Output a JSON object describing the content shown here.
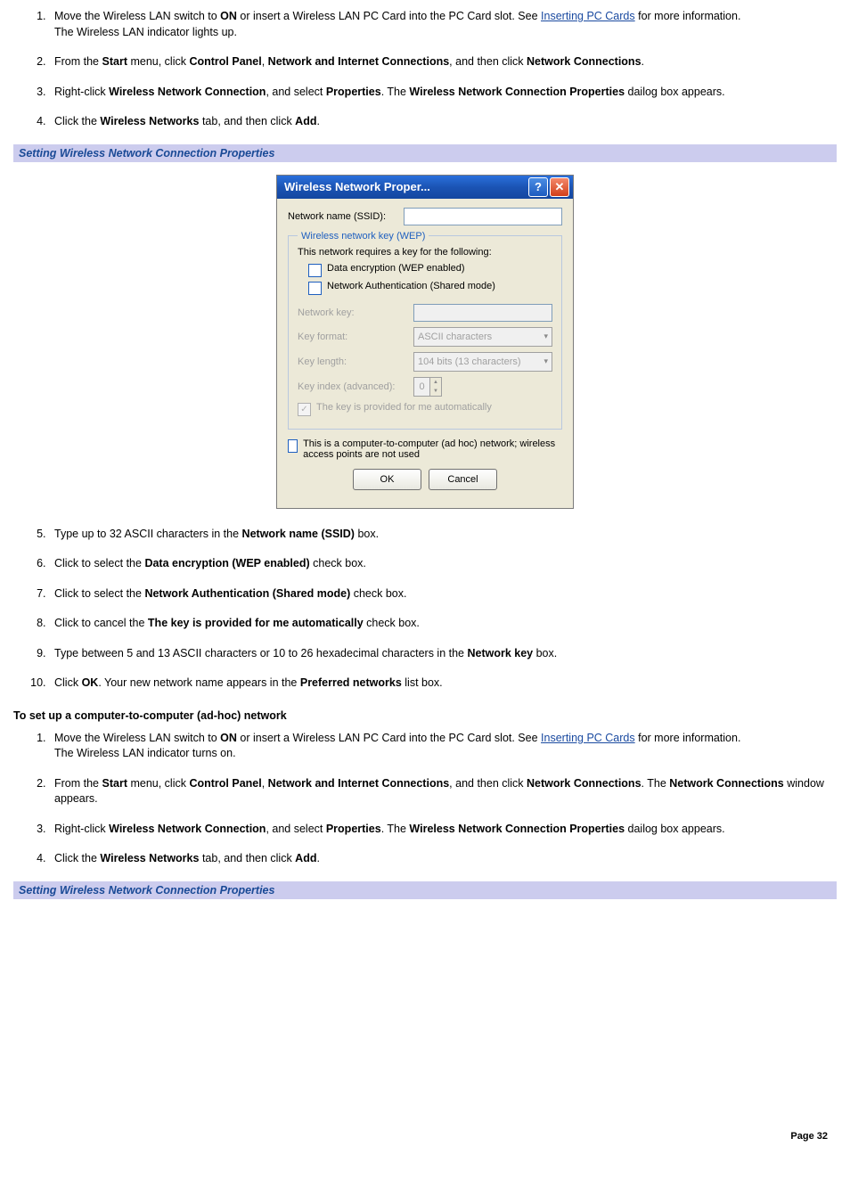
{
  "steps_a": {
    "s1_pre": "Move the Wireless LAN switch to ",
    "s1_b1": "ON",
    "s1_mid": " or insert a Wireless LAN PC Card into the PC Card slot. See ",
    "s1_link": "Inserting PC Cards",
    "s1_post": " for more information.",
    "s1_line2": "The Wireless LAN indicator lights up.",
    "s2_p0": "From the ",
    "s2_b1": "Start",
    "s2_p1": " menu, click ",
    "s2_b2": "Control Panel",
    "s2_p2": ", ",
    "s2_b3": "Network and Internet Connections",
    "s2_p3": ", and then click ",
    "s2_b4": "Network Connections",
    "s2_p4": ".",
    "s3_p0": "Right-click ",
    "s3_b1": "Wireless Network Connection",
    "s3_p1": ", and select ",
    "s3_b2": "Properties",
    "s3_p2": ". The ",
    "s3_b3": "Wireless Network Connection Properties",
    "s3_p3": " dailog box appears.",
    "s4_p0": "Click the ",
    "s4_b1": "Wireless Networks",
    "s4_p1": " tab, and then click ",
    "s4_b2": "Add",
    "s4_p2": "."
  },
  "caption1": "Setting Wireless Network Connection Properties",
  "dialog": {
    "title": "Wireless Network Proper...",
    "ssid_label": "Network name (SSID):",
    "wep_legend": "Wireless network key (WEP)",
    "wep_intro": "This network requires a key for the following:",
    "chk_dataenc": "Data encryption (WEP enabled)",
    "chk_netauth": "Network Authentication (Shared mode)",
    "lbl_netkey": "Network key:",
    "lbl_keyformat": "Key format:",
    "val_keyformat": "ASCII characters",
    "lbl_keylength": "Key length:",
    "val_keylength": "104 bits (13 characters)",
    "lbl_keyindex": "Key index (advanced):",
    "val_keyindex": "0",
    "chk_autokey": "The key is provided for me automatically",
    "chk_adhoc": "This is a computer-to-computer (ad hoc) network; wireless access points are not used",
    "btn_ok": "OK",
    "btn_cancel": "Cancel"
  },
  "steps_b": {
    "s5_p0": "Type up to 32 ASCII characters in the ",
    "s5_b1": "Network name (SSID)",
    "s5_p1": " box.",
    "s6_p0": "Click to select the ",
    "s6_b1": "Data encryption (WEP enabled)",
    "s6_p1": " check box.",
    "s7_p0": "Click to select the ",
    "s7_b1": "Network Authentication (Shared mode)",
    "s7_p1": " check box.",
    "s8_p0": "Click to cancel the ",
    "s8_b1": "The key is provided for me automatically",
    "s8_p1": " check box.",
    "s9_p0": "Type between 5 and 13 ASCII characters or 10 to 26 hexadecimal characters in the ",
    "s9_b1": "Network key",
    "s9_p1": " box.",
    "s10_p0": "Click ",
    "s10_b1": "OK",
    "s10_p1": ". Your new network name appears in the ",
    "s10_b2": "Preferred networks",
    "s10_p2": " list box."
  },
  "subheading2": "To set up a computer-to-computer (ad-hoc) network",
  "steps_c": {
    "s1_pre": "Move the Wireless LAN switch to ",
    "s1_b1": "ON",
    "s1_mid": " or insert a Wireless LAN PC Card into the PC Card slot. See ",
    "s1_link": "Inserting PC Cards",
    "s1_post": " for more information.",
    "s1_line2": "The Wireless LAN indicator turns on.",
    "s2_p0": "From the ",
    "s2_b1": "Start",
    "s2_p1": " menu, click ",
    "s2_b2": "Control Panel",
    "s2_p2": ", ",
    "s2_b3": "Network and Internet Connections",
    "s2_p3": ", and then click ",
    "s2_b4": "Network Connections",
    "s2_p4": ". The ",
    "s2_b5": "Network Connections",
    "s2_p5": " window appears.",
    "s3_p0": "Right-click ",
    "s3_b1": "Wireless Network Connection",
    "s3_p1": ", and select ",
    "s3_b2": "Properties",
    "s3_p2": ". The ",
    "s3_b3": "Wireless Network Connection Properties",
    "s3_p3": " dailog box appears.",
    "s4_p0": "Click the ",
    "s4_b1": "Wireless Networks",
    "s4_p1": " tab, and then click ",
    "s4_b2": "Add",
    "s4_p2": "."
  },
  "caption2": "Setting Wireless Network Connection Properties",
  "page_num": "Page 32"
}
